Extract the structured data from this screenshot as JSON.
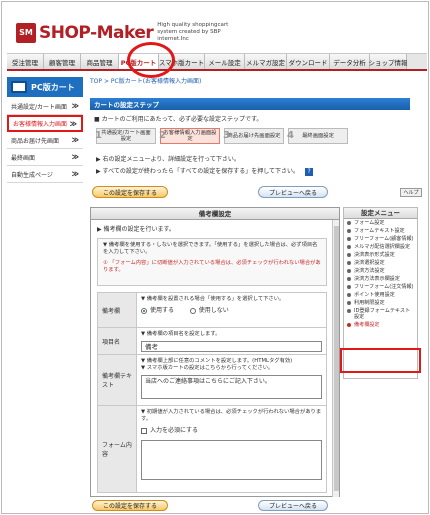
{
  "brand": {
    "logo_mark": "SM",
    "name": "SHOP-Maker",
    "tagline": "High quality shoppingcart system created by SBP internet.Inc"
  },
  "nav": {
    "tabs": [
      {
        "label": "受注管理",
        "active": false
      },
      {
        "label": "顧客管理",
        "active": false
      },
      {
        "label": "商品管理",
        "active": false
      },
      {
        "label": "PC版カート",
        "active": true
      },
      {
        "label": "スマホ版カート",
        "active": false
      },
      {
        "label": "メール設定",
        "active": false
      },
      {
        "label": "メルマガ設定",
        "active": false
      },
      {
        "label": "ダウンロード",
        "active": false
      },
      {
        "label": "データ分析",
        "active": false
      },
      {
        "label": "ショップ情報",
        "active": false
      }
    ]
  },
  "sidebar": {
    "title": "PC版カート",
    "items": [
      {
        "label": "共通設定/カート画面",
        "active": false
      },
      {
        "label": "お客様情報入力画面",
        "active": true
      },
      {
        "label": "商品お届け先画面",
        "active": false
      },
      {
        "label": "最終画面",
        "active": false
      },
      {
        "label": "自動生成ページ",
        "active": false
      }
    ],
    "arrow": "≫"
  },
  "breadcrumb": {
    "top": "TOP",
    "sep": ">",
    "current": "PC版カート(お客様情報入力画面)"
  },
  "main": {
    "title": "カートの設定ステップ",
    "intro": "■ カートのご利用にあたって、必ず必要な設定ステップです。",
    "steps": [
      {
        "num": "1",
        "label": "共通設定/カート画面設定"
      },
      {
        "num": "2",
        "label": "お客様情報入力画面設定"
      },
      {
        "num": "3",
        "label": "商品お届け先画面設定"
      },
      {
        "num": "4",
        "label": "最終画面設定"
      }
    ],
    "note1": "▶ 右の設定メニューより、詳細設定を行って下さい。",
    "note2": "▶ すべての設定が終わったら「すべての設定を保存する」を押して下さい。",
    "help_icon": "?",
    "save_button": "この設定を保存する",
    "prev_button": "プレビューへ戻る",
    "help_small": "ヘルプ"
  },
  "panel": {
    "title": "備考欄設定",
    "info_title": "▶ 備考欄の設定を行います。",
    "hint": "▼ 備考欄を使用する・しないを選択できます。「使用する」を選択した場合は、必ず項目名を入力して下さい。",
    "warn": "① 「フォーム内容」に切断値が入力されている場合は、必須チェックが行われない場合があります。",
    "rows": {
      "biko": {
        "label": "備考欄",
        "hint": "▼ 備考欄を設置される場合「使用する」を選択して下さい。",
        "opt_use": "使用する",
        "opt_nouse": "使用しない"
      },
      "koumoku": {
        "label": "項目名",
        "hint": "▼ 備考欄の項目名を設定します。",
        "value": "備考"
      },
      "text": {
        "label": "備考欄テキスト",
        "hint1": "▼ 備考欄上部に任意のコメントを設定します。(HTMLタグ有効)",
        "hint2": "▼ スマホ版カートの設定はこちらから行ってください。",
        "value": "当店へのご連絡事項はこちらにご記入下さい。"
      },
      "form": {
        "label": "フォーム内容",
        "hint": "▼ 初期値が入力されている場合は、必須チェックが行われない場合があります。",
        "chk": "入力を必須にする"
      }
    }
  },
  "settings_menu": {
    "title": "設定メニュー",
    "items": [
      {
        "label": "フォーム設定",
        "active": false
      },
      {
        "label": "フォームテキスト設定",
        "active": false
      },
      {
        "label": "フリーフォーム(顧客情報)",
        "active": false
      },
      {
        "label": "メルマガ配信選択欄設定",
        "active": false
      },
      {
        "label": "決済表示形式設定",
        "active": false
      },
      {
        "label": "決済選択設定",
        "active": false
      },
      {
        "label": "決済方法設定",
        "active": false
      },
      {
        "label": "決済方法表示欄設定",
        "active": false
      },
      {
        "label": "フリーフォーム(注文情報)",
        "active": false
      },
      {
        "label": "ポイント使用設定",
        "active": false
      },
      {
        "label": "利用制限設定",
        "active": false
      },
      {
        "label": "ID登録フォームテキスト設定",
        "active": false
      },
      {
        "label": "備考欄設定",
        "active": true
      }
    ]
  }
}
